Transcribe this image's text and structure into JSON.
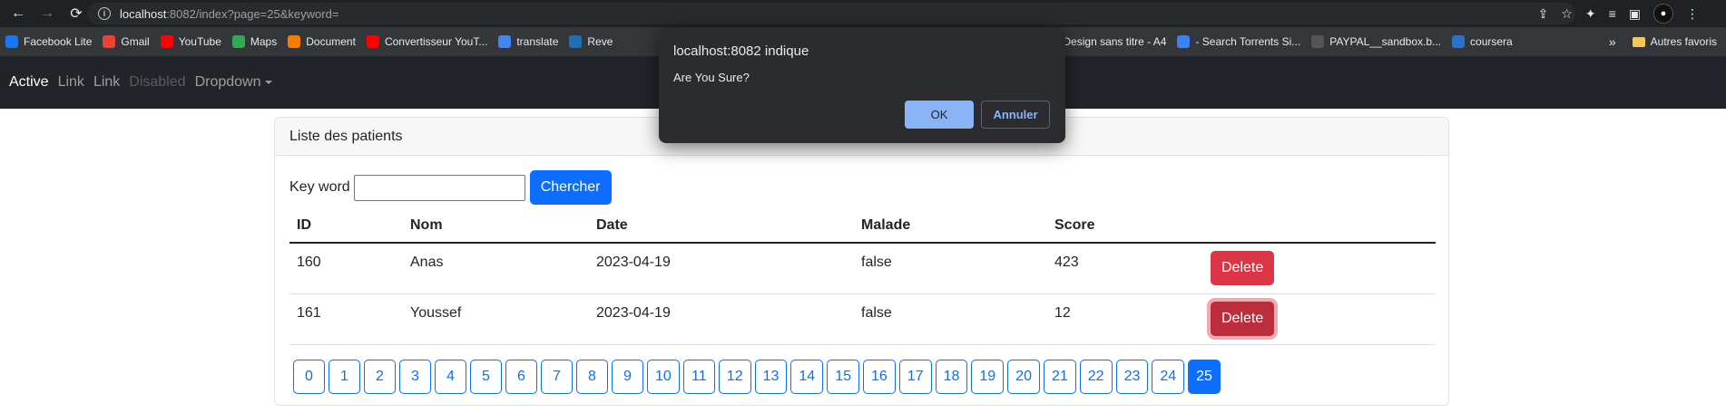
{
  "browser": {
    "url_host": "localhost",
    "url_rest": ":8082/index?page=25&keyword=",
    "bookmarks": [
      {
        "label": "Facebook Lite",
        "icon": "facebook-icon",
        "color": "#1877f2"
      },
      {
        "label": "Gmail",
        "icon": "gmail-icon",
        "color": "#ea4335"
      },
      {
        "label": "YouTube",
        "icon": "youtube-icon",
        "color": "#ff0000"
      },
      {
        "label": "Maps",
        "icon": "maps-icon",
        "color": "#34a853"
      },
      {
        "label": "Document",
        "icon": "document-icon",
        "color": "#f57c00"
      },
      {
        "label": "Convertisseur YouT...",
        "icon": "youtube-icon",
        "color": "#ff0000"
      },
      {
        "label": "translate",
        "icon": "translate-icon",
        "color": "#4285f4"
      },
      {
        "label": "Reve",
        "icon": "reverso-icon",
        "color": "#1f6fb6"
      },
      {
        "label": "Design sans titre - A4",
        "icon": "canva-icon",
        "color": "#00c4cc"
      },
      {
        "label": "- Search Torrents Si...",
        "icon": "torrent-icon",
        "color": "#3b82f6"
      },
      {
        "label": "PAYPAL__sandbox.b...",
        "icon": "paypal-icon",
        "color": "#555555"
      },
      {
        "label": "coursera",
        "icon": "coursera-icon",
        "color": "#2a73cc"
      }
    ],
    "more_bookmarks": "»",
    "other_bookmarks": "Autres favoris"
  },
  "navbar": {
    "items": [
      {
        "label": "Active",
        "state": "active"
      },
      {
        "label": "Link",
        "state": "normal"
      },
      {
        "label": "Link",
        "state": "normal"
      },
      {
        "label": "Disabled",
        "state": "disabled"
      },
      {
        "label": "Dropdown",
        "state": "dropdown"
      }
    ]
  },
  "card": {
    "header": "Liste des patients",
    "search_label": "Key word",
    "search_value": "",
    "search_button": "Chercher",
    "columns": [
      "ID",
      "Nom",
      "Date",
      "Malade",
      "Score"
    ],
    "rows": [
      {
        "id": "160",
        "nom": "Anas",
        "date": "2023-04-19",
        "malade": "false",
        "score": "423",
        "action": "Delete"
      },
      {
        "id": "161",
        "nom": "Youssef",
        "date": "2023-04-19",
        "malade": "false",
        "score": "12",
        "action": "Delete"
      }
    ],
    "pages": [
      "0",
      "1",
      "2",
      "3",
      "4",
      "5",
      "6",
      "7",
      "8",
      "9",
      "10",
      "11",
      "12",
      "13",
      "14",
      "15",
      "16",
      "17",
      "18",
      "19",
      "20",
      "21",
      "22",
      "23",
      "24",
      "25"
    ],
    "current_page": "25"
  },
  "dialog": {
    "title": "localhost:8082 indique",
    "message": "Are You Sure?",
    "ok_label": "OK",
    "cancel_label": "Annuler"
  },
  "colors": {
    "primary": "#0d6efd",
    "danger": "#dc3545",
    "navbar_bg": "#212529"
  }
}
